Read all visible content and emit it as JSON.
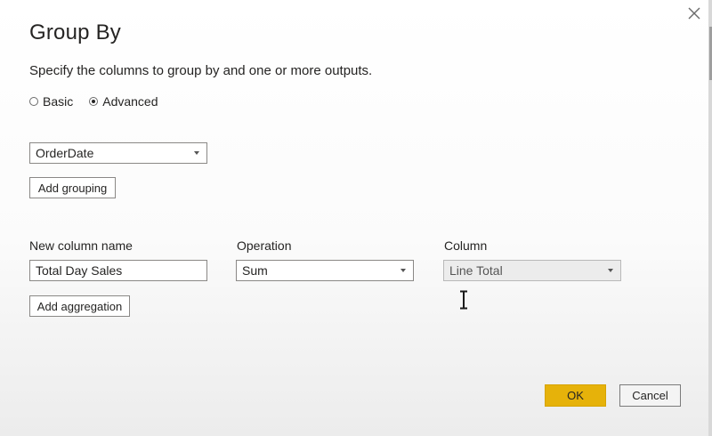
{
  "dialog": {
    "title": "Group By",
    "subtitle": "Specify the columns to group by and one or more outputs.",
    "close_icon": "close-icon"
  },
  "mode": {
    "options": [
      {
        "label": "Basic",
        "checked": false
      },
      {
        "label": "Advanced",
        "checked": true
      }
    ]
  },
  "grouping": {
    "selected": "OrderDate",
    "add_label": "Add grouping"
  },
  "aggregation": {
    "headers": {
      "new_column": "New column name",
      "operation": "Operation",
      "column": "Column"
    },
    "row": {
      "new_column_value": "Total Day Sales",
      "operation_value": "Sum",
      "column_value": "Line Total"
    },
    "add_label": "Add aggregation"
  },
  "footer": {
    "ok_label": "OK",
    "cancel_label": "Cancel"
  },
  "colors": {
    "accent": "#e6b20a",
    "border": "#8a8886",
    "text": "#252423"
  }
}
